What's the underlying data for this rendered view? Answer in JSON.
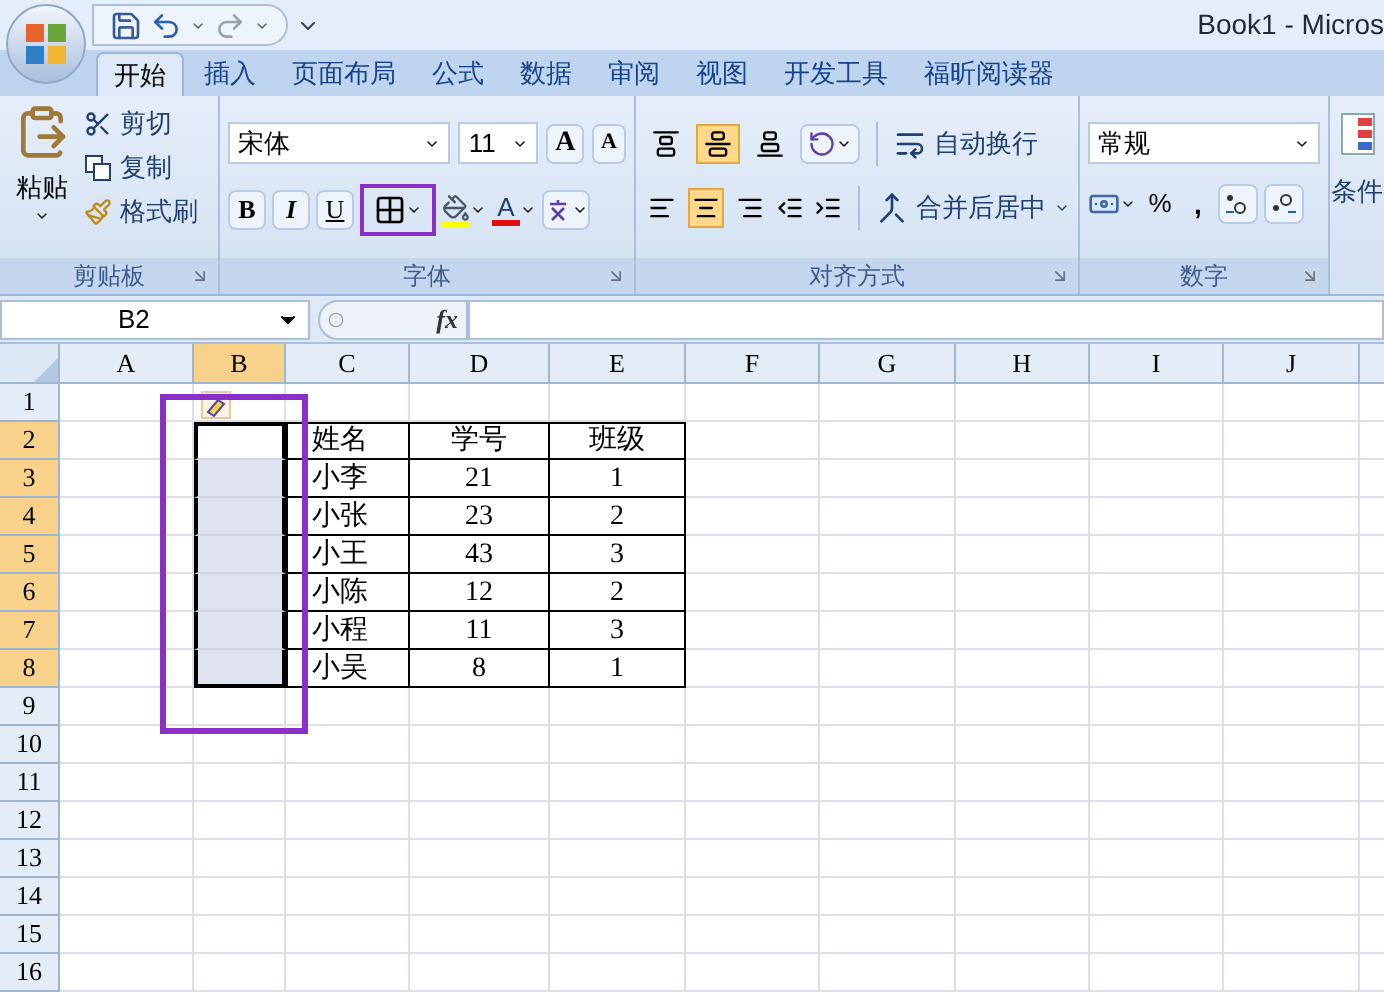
{
  "window": {
    "title": "Book1 - Micros"
  },
  "tabs": [
    {
      "label": "开始",
      "selected": true
    },
    {
      "label": "插入",
      "selected": false
    },
    {
      "label": "页面布局",
      "selected": false
    },
    {
      "label": "公式",
      "selected": false
    },
    {
      "label": "数据",
      "selected": false
    },
    {
      "label": "审阅",
      "selected": false
    },
    {
      "label": "视图",
      "selected": false
    },
    {
      "label": "开发工具",
      "selected": false
    },
    {
      "label": "福昕阅读器",
      "selected": false
    }
  ],
  "ribbon": {
    "clipboard": {
      "paste": "粘贴",
      "cut": "剪切",
      "copy": "复制",
      "format_painter": "格式刷",
      "group": "剪贴板"
    },
    "font": {
      "name": "宋体",
      "size": "11",
      "grow": "A",
      "shrink": "A",
      "bold": "B",
      "italic": "I",
      "underline": "U",
      "borders_highlighted": true,
      "font_color": "A",
      "group": "字体"
    },
    "alignment": {
      "vertical": [
        {
          "selected": false
        },
        {
          "selected": true
        },
        {
          "selected": false
        }
      ],
      "horizontal": [
        {
          "selected": false
        },
        {
          "selected": true
        },
        {
          "selected": false
        }
      ],
      "wrap": "自动换行",
      "merge": "合并后居中",
      "group": "对齐方式"
    },
    "number": {
      "format": "常规",
      "percent": "%",
      "comma": ",",
      "group": "数字"
    },
    "styles": {
      "conditional": "条件"
    }
  },
  "formula_bar": {
    "name_box": "B2",
    "fx": "fx"
  },
  "sheet": {
    "columns": [
      {
        "label": "A",
        "selected": false
      },
      {
        "label": "B",
        "selected": true
      },
      {
        "label": "C",
        "selected": false
      },
      {
        "label": "D",
        "selected": false
      },
      {
        "label": "E",
        "selected": false
      },
      {
        "label": "F",
        "selected": false
      },
      {
        "label": "G",
        "selected": false
      },
      {
        "label": "H",
        "selected": false
      },
      {
        "label": "I",
        "selected": false
      },
      {
        "label": "J",
        "selected": false
      }
    ],
    "rows": [
      {
        "label": "1",
        "selected": false
      },
      {
        "label": "2",
        "selected": true
      },
      {
        "label": "3",
        "selected": true
      },
      {
        "label": "4",
        "selected": true
      },
      {
        "label": "5",
        "selected": true
      },
      {
        "label": "6",
        "selected": true
      },
      {
        "label": "7",
        "selected": true
      },
      {
        "label": "8",
        "selected": true
      },
      {
        "label": "9",
        "selected": false
      },
      {
        "label": "10",
        "selected": false
      },
      {
        "label": "11",
        "selected": false
      },
      {
        "label": "12",
        "selected": false
      },
      {
        "label": "13",
        "selected": false
      },
      {
        "label": "14",
        "selected": false
      },
      {
        "label": "15",
        "selected": false
      },
      {
        "label": "16",
        "selected": false
      }
    ],
    "selection_highlighted": true,
    "table": {
      "columns": [
        "姓名",
        "学号",
        "班级"
      ],
      "rows": [
        [
          "小李",
          "21",
          "1"
        ],
        [
          "小张",
          "23",
          "2"
        ],
        [
          "小王",
          "43",
          "3"
        ],
        [
          "小陈",
          "12",
          "2"
        ],
        [
          "小程",
          "11",
          "3"
        ],
        [
          "小吴",
          "8",
          "1"
        ]
      ]
    }
  }
}
